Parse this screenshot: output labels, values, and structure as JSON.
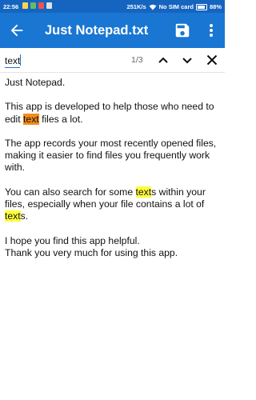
{
  "status_bar": {
    "time": "22:56",
    "speed": "251K/s",
    "sim": "No SIM card",
    "battery": "88%",
    "battery_level": 0.88
  },
  "toolbar": {
    "title": "Just Notepad.txt"
  },
  "search": {
    "query": "text",
    "count": "1/3"
  },
  "document": {
    "p1": "Just Notepad.",
    "p2a": "This app is developed to help those who need to edit ",
    "p2b": "text",
    "p2c": " files a lot.",
    "p3": "The app records your most recently opened files, making it easier to find files you frequently work with.",
    "p4a": "You can also search for some ",
    "p4b": "text",
    "p4c": "s within your files, especially when your file contains a lot of ",
    "p4d": "text",
    "p4e": "s.",
    "p5a": "I hope you find this app helpful.",
    "p5b": "Thank you very much for using this app."
  },
  "colors": {
    "toolbar": "#1976d2",
    "status_bar": "#1565c0",
    "highlight": "#ffff3b",
    "highlight_current": "#f28c1c"
  },
  "icons": [
    "back-arrow-icon",
    "save-icon",
    "more-vert-icon",
    "chevron-up-icon",
    "chevron-down-icon",
    "close-icon"
  ]
}
